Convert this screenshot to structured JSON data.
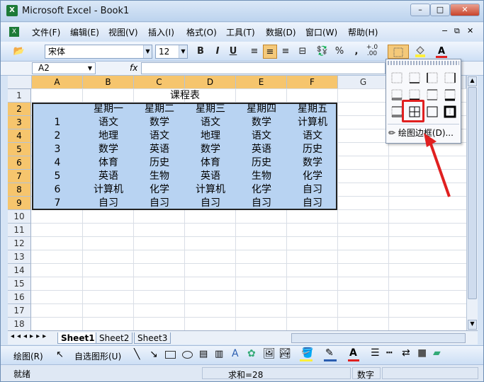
{
  "window": {
    "title": "Microsoft Excel - Book1",
    "min": "–",
    "max": "□",
    "close": "✕"
  },
  "menu": [
    "文件(F)",
    "编辑(E)",
    "视图(V)",
    "插入(I)",
    "格式(O)",
    "工具(T)",
    "数据(D)",
    "窗口(W)",
    "帮助(H)"
  ],
  "toolbar": {
    "font": "宋体",
    "size": "12",
    "bold": "B",
    "italic": "I",
    "underline": "U",
    "percent": "%",
    "comma": ",",
    "decimal": "+.0\n.00"
  },
  "formula": {
    "namebox": "A2",
    "fx": "fx"
  },
  "columns": [
    "A",
    "B",
    "C",
    "D",
    "E",
    "F",
    "G"
  ],
  "rows": [
    "1",
    "2",
    "3",
    "4",
    "5",
    "6",
    "7",
    "8",
    "9",
    "10",
    "11",
    "12",
    "13",
    "14",
    "15",
    "16",
    "17",
    "18"
  ],
  "sheet_title": "课程表",
  "header_row": [
    "",
    "星期一",
    "星期二",
    "星期三",
    "星期四",
    "星期五"
  ],
  "table_rows": [
    [
      "1",
      "语文",
      "数学",
      "语文",
      "数学",
      "计算机"
    ],
    [
      "2",
      "地理",
      "语文",
      "地理",
      "语文",
      "语文"
    ],
    [
      "3",
      "数学",
      "英语",
      "数学",
      "英语",
      "历史"
    ],
    [
      "4",
      "体育",
      "历史",
      "体育",
      "历史",
      "数学"
    ],
    [
      "5",
      "英语",
      "生物",
      "英语",
      "生物",
      "化学"
    ],
    [
      "6",
      "计算机",
      "化学",
      "计算机",
      "化学",
      "自习"
    ],
    [
      "7",
      "自习",
      "自习",
      "自习",
      "自习",
      "自习"
    ]
  ],
  "tabs": [
    "Sheet1",
    "Sheet2",
    "Sheet3"
  ],
  "drawbar": {
    "draw": "绘图(R)",
    "autoshape": "自选图形(U)"
  },
  "status": {
    "ready": "就绪",
    "sum": "求和=28",
    "numlock": "数字"
  },
  "popup": {
    "draw_borders": "绘图边框(D)..."
  },
  "colors": {
    "selection": "#b8d3f2",
    "header_sel": "#f6c56d",
    "highlight": "#e02020"
  }
}
